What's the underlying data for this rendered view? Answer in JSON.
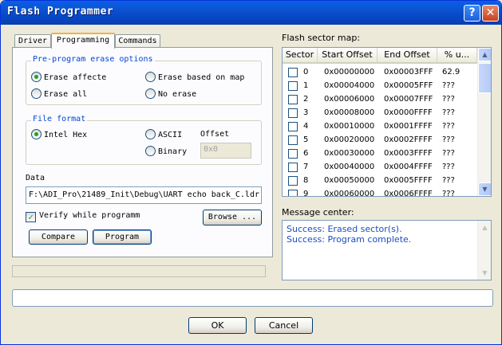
{
  "window": {
    "title": "Flash Programmer"
  },
  "titlebar": {
    "help": "?",
    "close": "✕"
  },
  "tabs": [
    "Driver",
    "Programming",
    "Commands"
  ],
  "erase": {
    "legend": "Pre-program erase options",
    "opt1": "Erase affecte",
    "opt2": "Erase based on map",
    "opt3": "Erase all",
    "opt4": "No erase"
  },
  "format": {
    "legend": "File format",
    "opt1": "Intel Hex",
    "opt2": "ASCII",
    "opt3": "Binary",
    "offset_label": "Offset",
    "offset_value": "0x0"
  },
  "data": {
    "label": "Data",
    "path": "F:\\ADI_Pro\\21489_Init\\Debug\\UART echo back_C.ldr",
    "verify": "Verify while programm",
    "browse": "Browse ..."
  },
  "actions": {
    "compare": "Compare",
    "program": "Program"
  },
  "sectors": {
    "label": "Flash sector map:",
    "headers": [
      "Sector",
      "Start Offset",
      "End Offset",
      "% u..."
    ],
    "rows": [
      [
        "0",
        "0x00000000",
        "0x00003FFF",
        "62.9"
      ],
      [
        "1",
        "0x00004000",
        "0x00005FFF",
        "???"
      ],
      [
        "2",
        "0x00006000",
        "0x00007FFF",
        "???"
      ],
      [
        "3",
        "0x00008000",
        "0x0000FFFF",
        "???"
      ],
      [
        "4",
        "0x00010000",
        "0x0001FFFF",
        "???"
      ],
      [
        "5",
        "0x00020000",
        "0x0002FFFF",
        "???"
      ],
      [
        "6",
        "0x00030000",
        "0x0003FFFF",
        "???"
      ],
      [
        "7",
        "0x00040000",
        "0x0004FFFF",
        "???"
      ],
      [
        "8",
        "0x00050000",
        "0x0005FFFF",
        "???"
      ],
      [
        "9",
        "0x00060000",
        "0x0006FFFF",
        "???"
      ]
    ]
  },
  "messages": {
    "label": "Message center:",
    "lines": [
      "Success: Erased sector(s).",
      "Success: Program complete."
    ]
  },
  "footer": {
    "ok": "OK",
    "cancel": "Cancel"
  }
}
